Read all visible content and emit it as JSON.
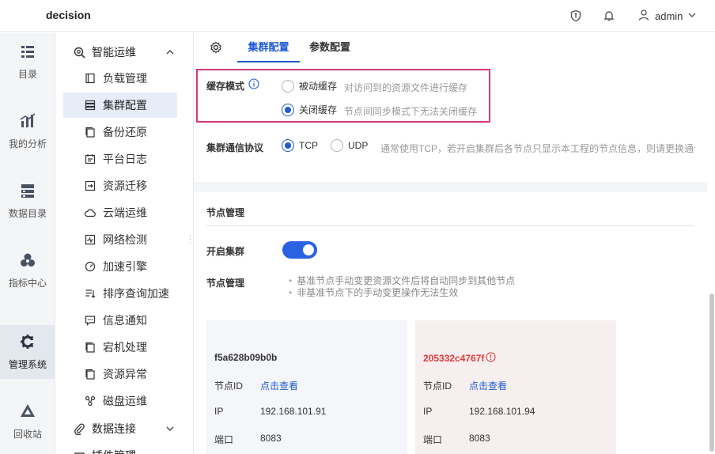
{
  "app": {
    "brand": "decision",
    "user": "admin"
  },
  "rail": [
    {
      "label": "目录",
      "icon": "catalog-icon"
    },
    {
      "label": "我的分析",
      "icon": "analysis-icon"
    },
    {
      "label": "数据目录",
      "icon": "data-catalog-icon"
    },
    {
      "label": "指标中心",
      "icon": "metrics-icon"
    },
    {
      "label": "管理系统",
      "icon": "management-gear-icon",
      "active": true
    },
    {
      "label": "回收站",
      "icon": "recycle-icon"
    }
  ],
  "submenu": {
    "group1": "智能运维",
    "items": [
      {
        "label": "负载管理",
        "icon": "load-icon"
      },
      {
        "label": "集群配置",
        "icon": "cluster-icon",
        "active": true
      },
      {
        "label": "备份还原",
        "icon": "backup-icon"
      },
      {
        "label": "平台日志",
        "icon": "log-icon"
      },
      {
        "label": "资源迁移",
        "icon": "migrate-icon"
      },
      {
        "label": "云端运维",
        "icon": "cloud-icon"
      },
      {
        "label": "网络检测",
        "icon": "network-icon"
      },
      {
        "label": "加速引擎",
        "icon": "speed-icon"
      },
      {
        "label": "排序查询加速",
        "icon": "sort-icon"
      },
      {
        "label": "信息通知",
        "icon": "notify-icon"
      },
      {
        "label": "宕机处理",
        "icon": "crash-icon"
      },
      {
        "label": "资源异常",
        "icon": "resource-error-icon"
      },
      {
        "label": "磁盘运维",
        "icon": "disk-icon"
      }
    ],
    "group2": "数据连接",
    "group3": "插件管理"
  },
  "tabs": [
    {
      "label": "集群配置",
      "active": true
    },
    {
      "label": "参数配置"
    }
  ],
  "cache": {
    "label": "缓存模式",
    "options": [
      {
        "label": "被动缓存",
        "hint": "对访问到的资源文件进行缓存",
        "selected": false
      },
      {
        "label": "关闭缓存",
        "hint": "节点间同步模式下无法关闭缓存",
        "selected": true
      }
    ]
  },
  "protocol": {
    "label": "集群通信协议",
    "options": [
      {
        "label": "TCP",
        "selected": true
      },
      {
        "label": "UDP",
        "selected": false
      }
    ],
    "hint": "通常使用TCP，若开启集群后各节点只显示本工程的节点信息，则请更换通信"
  },
  "nodes": {
    "section_title": "节点管理",
    "enable_label": "开启集群",
    "enabled": true,
    "manage_label": "节点管理",
    "bullets": [
      "基准节点手动变更资源文件后将自动同步到其他节点",
      "非基准节点下的手动变更操作无法生效"
    ],
    "cards": [
      {
        "title": "f5a628b09b0b",
        "id_label": "节点ID",
        "id_value": "点击查看",
        "ip_label": "IP",
        "ip": "192.168.101.91",
        "port_label": "端口",
        "port": "8083",
        "warning": false
      },
      {
        "title": "205332c4767f",
        "id_label": "节点ID",
        "id_value": "点击查看",
        "ip_label": "IP",
        "ip": "192.168.101.94",
        "port_label": "端口",
        "port": "8083",
        "warning": true
      }
    ]
  },
  "colors": {
    "accent": "#1f5bd8",
    "highlight": "#d33a7a",
    "warning": "#e03a3a"
  }
}
